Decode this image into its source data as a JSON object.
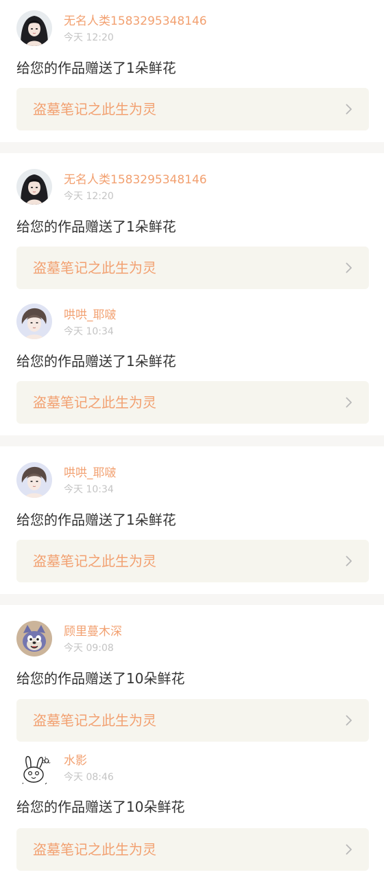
{
  "colors": {
    "accent": "#f2a070",
    "time": "#c4c4c4",
    "text": "#333333",
    "link_bg": "#f6f5ee",
    "separator": "#f7f6f4",
    "chevron": "#b8b8b8"
  },
  "notifications": [
    {
      "username": "无名人类1583295348146",
      "time": "今天 12:20",
      "message": "给您的作品赠送了1朵鲜花",
      "work_title": "盗墓笔记之此生为灵",
      "avatar_icon": "dark-haired-girl-avatar"
    },
    {
      "username": "无名人类1583295348146",
      "time": "今天 12:20",
      "message": "给您的作品赠送了1朵鲜花",
      "work_title": "盗墓笔记之此生为灵",
      "avatar_icon": "dark-haired-girl-avatar"
    },
    {
      "username": "哄哄_耶啵",
      "time": "今天 10:34",
      "message": "给您的作品赠送了1朵鲜花",
      "work_title": "盗墓笔记之此生为灵",
      "avatar_icon": "illustrated-boy-avatar"
    },
    {
      "username": "哄哄_耶啵",
      "time": "今天 10:34",
      "message": "给您的作品赠送了1朵鲜花",
      "work_title": "盗墓笔记之此生为灵",
      "avatar_icon": "illustrated-boy-avatar"
    },
    {
      "username": "顾里蔓木深",
      "time": "今天 09:08",
      "message": "给您的作品赠送了10朵鲜花",
      "work_title": "盗墓笔记之此生为灵",
      "avatar_icon": "cartoon-cat-avatar"
    },
    {
      "username": "水影",
      "time": "今天 08:46",
      "message": "给您的作品赠送了10朵鲜花",
      "work_title": "盗墓笔记之此生为灵",
      "avatar_icon": "doodle-bunny-avatar"
    }
  ]
}
